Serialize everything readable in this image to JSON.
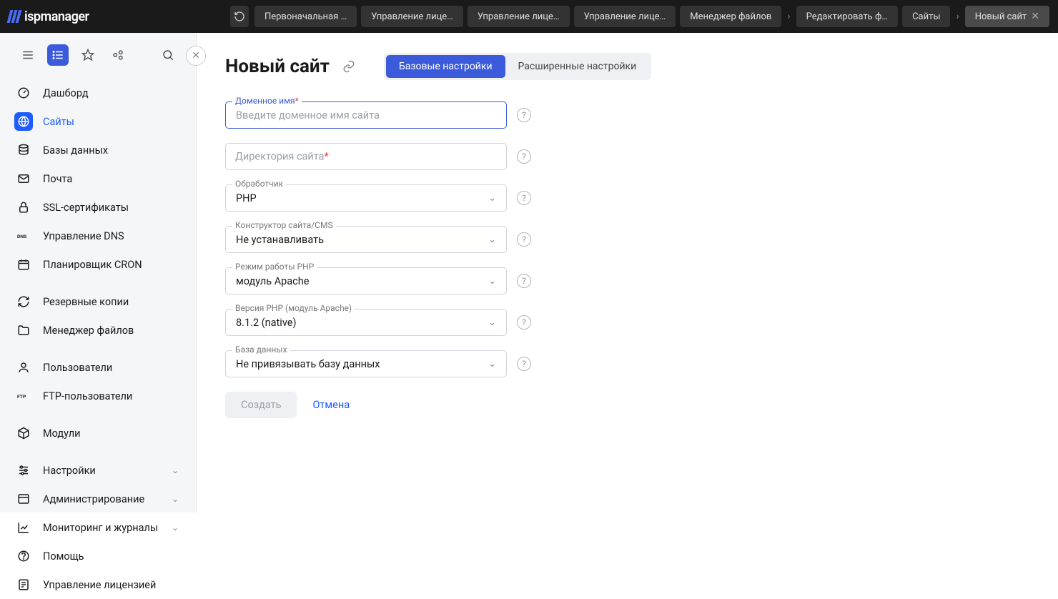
{
  "brand": "ispmanager",
  "topTabs": [
    {
      "label": "Первоначальная …"
    },
    {
      "label": "Управление лице…"
    },
    {
      "label": "Управление лице…"
    },
    {
      "label": "Управление лице…"
    },
    {
      "label": "Менеджер файлов"
    },
    {
      "sep": true
    },
    {
      "label": "Редактировать ф…"
    },
    {
      "label": "Сайты"
    },
    {
      "sep": true
    },
    {
      "label": "Новый сайт",
      "active": true,
      "closable": true
    }
  ],
  "sidebar": {
    "items": [
      {
        "label": "Дашборд",
        "icon": "gauge"
      },
      {
        "label": "Сайты",
        "icon": "globe",
        "active": true
      },
      {
        "label": "Базы данных",
        "icon": "database"
      },
      {
        "label": "Почта",
        "icon": "mail"
      },
      {
        "label": "SSL-сертификаты",
        "icon": "lock"
      },
      {
        "label": "Управление DNS",
        "icon": "dns"
      },
      {
        "label": "Планировщик CRON",
        "icon": "calendar"
      },
      {
        "sep": true
      },
      {
        "label": "Резервные копии",
        "icon": "refresh"
      },
      {
        "label": "Менеджер файлов",
        "icon": "folder"
      },
      {
        "sep": true
      },
      {
        "label": "Пользователи",
        "icon": "user"
      },
      {
        "label": "FTP-пользователи",
        "icon": "ftp"
      },
      {
        "sep": true
      },
      {
        "label": "Модули",
        "icon": "package"
      },
      {
        "sep": true
      },
      {
        "label": "Настройки",
        "icon": "sliders",
        "expandable": true
      },
      {
        "label": "Администрирование",
        "icon": "window",
        "expandable": true
      },
      {
        "label": "Мониторинг и журналы",
        "icon": "chart",
        "expandable": true
      },
      {
        "label": "Помощь",
        "icon": "help"
      },
      {
        "label": "Управление лицензией",
        "icon": "license"
      }
    ]
  },
  "page": {
    "title": "Новый сайт",
    "tabBasic": "Базовые настройки",
    "tabAdvanced": "Расширенные настройки"
  },
  "form": {
    "domain": {
      "label": "Доменное имя",
      "placeholder": "Введите доменное имя сайта",
      "required": true
    },
    "directory": {
      "label": "Директория сайта",
      "required": true
    },
    "handler": {
      "label": "Обработчик",
      "value": "PHP"
    },
    "cms": {
      "label": "Конструктор сайта/CMS",
      "value": "Не устанавливать"
    },
    "phpMode": {
      "label": "Режим работы PHP",
      "value": "модуль Apache"
    },
    "phpVersion": {
      "label": "Версия PHP (модуль Apache)",
      "value": "8.1.2 (native)"
    },
    "database": {
      "label": "База данных",
      "value": "Не привязывать базу данных"
    }
  },
  "actions": {
    "create": "Создать",
    "cancel": "Отмена"
  }
}
